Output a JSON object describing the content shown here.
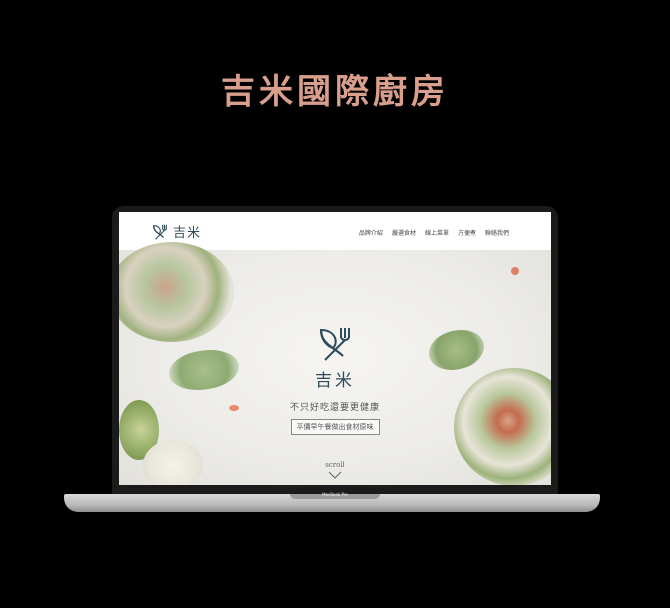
{
  "promo": {
    "title": "吉米國際廚房"
  },
  "site": {
    "logo_text": "吉米",
    "nav": [
      "品牌介紹",
      "嚴選食材",
      "線上菜單",
      "方便煮",
      "聯絡我們"
    ]
  },
  "hero": {
    "brand": "吉米",
    "slogan": "不只好吃還要更健康",
    "subtitle": "平價早午餐做出食材原味",
    "scroll_label": "scroll"
  },
  "device": {
    "model_label": "MacBook Pro"
  },
  "colors": {
    "accent": "#d99f8c",
    "brand": "#2f4a5a",
    "background": "#000000"
  },
  "icons": {
    "logo": "fork-leaf-icon",
    "scroll": "chevron-down-icon"
  }
}
